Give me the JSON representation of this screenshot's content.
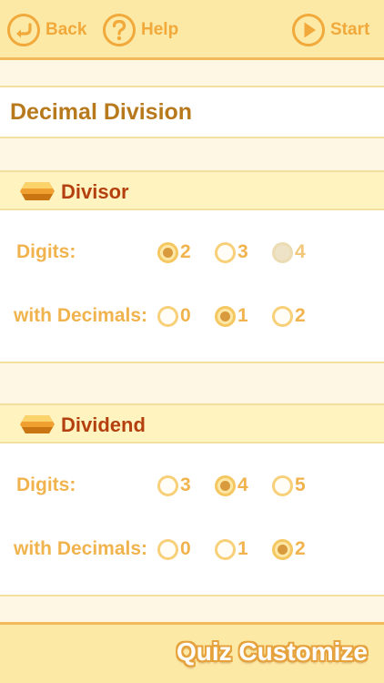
{
  "toolbar": {
    "back_label": "Back",
    "help_label": "Help",
    "start_label": "Start"
  },
  "page": {
    "title": "Decimal Division"
  },
  "divisor": {
    "title": "Divisor",
    "digits": {
      "label": "Digits:",
      "options": [
        "2",
        "3",
        "4"
      ],
      "selected": "2",
      "disabled": [
        "4"
      ]
    },
    "decimals": {
      "label": "with Decimals:",
      "options": [
        "0",
        "1",
        "2"
      ],
      "selected": "1"
    }
  },
  "dividend": {
    "title": "Dividend",
    "digits": {
      "label": "Digits:",
      "options": [
        "3",
        "4",
        "5"
      ],
      "selected": "4"
    },
    "decimals": {
      "label": "with Decimals:",
      "options": [
        "0",
        "1",
        "2"
      ],
      "selected": "2"
    }
  },
  "footer": {
    "brand": "Quiz Customize"
  },
  "colors": {
    "toolbar_bg": "#fde9a6",
    "accent": "#f0a93a",
    "title_text": "#b7791c",
    "section_title": "#b43f0f",
    "label_text": "#f0b34d"
  },
  "icons": {
    "back": "back-arrow-icon",
    "help": "question-icon",
    "start": "play-icon",
    "section": "gem-icon"
  }
}
